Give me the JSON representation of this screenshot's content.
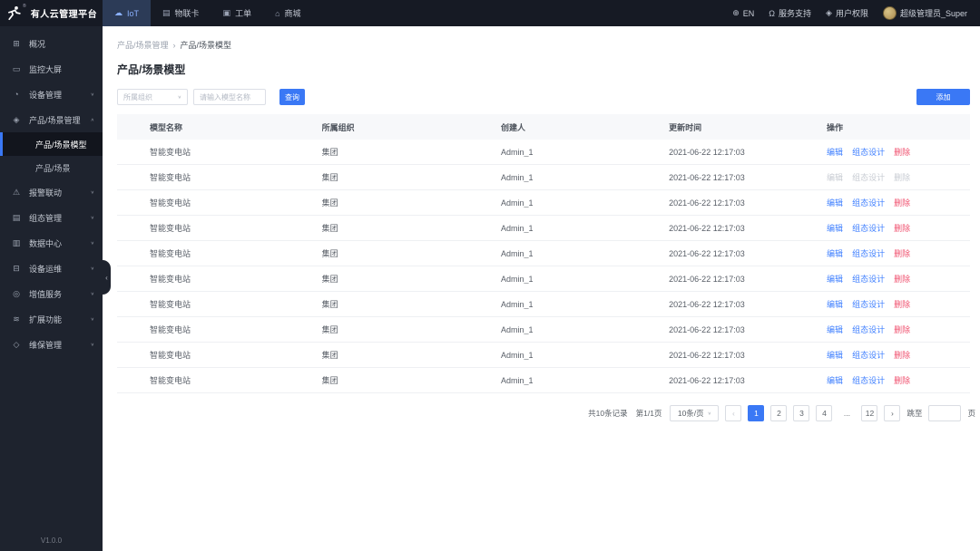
{
  "colors": {
    "accent": "#3a78f5",
    "link": "#4080ff",
    "danger": "#f0506e",
    "disabled": "#c8ccd3"
  },
  "icons": {
    "cloud-icon": "☁",
    "sim-card-icon": "▤",
    "work-order-icon": "▣",
    "store-icon": "⌂",
    "globe-icon": "⊕",
    "headset-icon": "Ω",
    "shield-icon": "◈",
    "overview-icon": "⊞",
    "monitor-icon": "▭",
    "device-manage-icon": "◔",
    "product-scene-icon": "◈",
    "alarm-icon": "⚠",
    "scada-icon": "▤",
    "data-center-icon": "▥",
    "device-ops-icon": "⊟",
    "value-added-icon": "◎",
    "extend-icon": "≋",
    "maintenance-icon": "◇",
    "chevron-down-icon": "∨",
    "chevron-up-icon": "∧",
    "collapse-icon": "‹"
  },
  "topbar": {
    "logo_text": "有人云管理平台",
    "reg_mark": "®",
    "nav": [
      {
        "key": "iot",
        "label": "IoT",
        "icon": "cloud-icon",
        "active": true
      },
      {
        "key": "sim",
        "label": "物联卡",
        "icon": "sim-card-icon",
        "active": false
      },
      {
        "key": "workorder",
        "label": "工单",
        "icon": "work-order-icon",
        "active": false
      },
      {
        "key": "mall",
        "label": "商城",
        "icon": "store-icon",
        "active": false
      }
    ],
    "right": {
      "lang": "EN",
      "support": "服务支持",
      "permission": "用户权限",
      "user": "超级管理员_Super"
    }
  },
  "sidebar": {
    "items": [
      {
        "key": "overview",
        "label": "概况",
        "icon": "overview-icon",
        "expandable": false
      },
      {
        "key": "monitor-screen",
        "label": "监控大屏",
        "icon": "monitor-icon",
        "expandable": false
      },
      {
        "key": "device-manage",
        "label": "设备管理",
        "icon": "device-manage-icon",
        "expandable": true,
        "expanded": false
      },
      {
        "key": "product-scene-manage",
        "label": "产品/场景管理",
        "icon": "product-scene-icon",
        "expandable": true,
        "expanded": true,
        "children": [
          {
            "key": "product-scene-model",
            "label": "产品/场景模型",
            "active": true
          },
          {
            "key": "product-scene",
            "label": "产品/场景",
            "active": false
          }
        ]
      },
      {
        "key": "alarm-linkage",
        "label": "报警联动",
        "icon": "alarm-icon",
        "expandable": true,
        "expanded": false
      },
      {
        "key": "scada-manage",
        "label": "组态管理",
        "icon": "scada-icon",
        "expandable": true,
        "expanded": false
      },
      {
        "key": "data-center",
        "label": "数据中心",
        "icon": "data-center-icon",
        "expandable": true,
        "expanded": false
      },
      {
        "key": "device-ops",
        "label": "设备运维",
        "icon": "device-ops-icon",
        "expandable": true,
        "expanded": false
      },
      {
        "key": "value-added",
        "label": "增值服务",
        "icon": "value-added-icon",
        "expandable": true,
        "expanded": false
      },
      {
        "key": "extend-func",
        "label": "扩展功能",
        "icon": "extend-icon",
        "expandable": true,
        "expanded": false
      },
      {
        "key": "maintenance",
        "label": "维保管理",
        "icon": "maintenance-icon",
        "expandable": true,
        "expanded": false
      }
    ],
    "version": "V1.0.0"
  },
  "breadcrumb": {
    "parent": "产品/场景管理",
    "separator": "›",
    "current": "产品/场景模型"
  },
  "page": {
    "title": "产品/场景模型"
  },
  "filters": {
    "org_select_placeholder": "所属组织",
    "model_input_placeholder": "请输入模型名称",
    "search_label": "查询",
    "add_label": "添加"
  },
  "table": {
    "columns": [
      "模型名称",
      "所属组织",
      "创建人",
      "更新时间",
      "操作"
    ],
    "action_labels": {
      "edit": "编辑",
      "design": "组态设计",
      "delete": "删除"
    },
    "rows": [
      {
        "name": "智能变电站",
        "org": "集团",
        "creator": "Admin_1",
        "updated": "2021-06-22 12:17:03",
        "disabled": false
      },
      {
        "name": "智能变电站",
        "org": "集团",
        "creator": "Admin_1",
        "updated": "2021-06-22 12:17:03",
        "disabled": true
      },
      {
        "name": "智能变电站",
        "org": "集团",
        "creator": "Admin_1",
        "updated": "2021-06-22 12:17:03",
        "disabled": false
      },
      {
        "name": "智能变电站",
        "org": "集团",
        "creator": "Admin_1",
        "updated": "2021-06-22 12:17:03",
        "disabled": false
      },
      {
        "name": "智能变电站",
        "org": "集团",
        "creator": "Admin_1",
        "updated": "2021-06-22 12:17:03",
        "disabled": false
      },
      {
        "name": "智能变电站",
        "org": "集团",
        "creator": "Admin_1",
        "updated": "2021-06-22 12:17:03",
        "disabled": false
      },
      {
        "name": "智能变电站",
        "org": "集团",
        "creator": "Admin_1",
        "updated": "2021-06-22 12:17:03",
        "disabled": false
      },
      {
        "name": "智能变电站",
        "org": "集团",
        "creator": "Admin_1",
        "updated": "2021-06-22 12:17:03",
        "disabled": false
      },
      {
        "name": "智能变电站",
        "org": "集团",
        "creator": "Admin_1",
        "updated": "2021-06-22 12:17:03",
        "disabled": false
      },
      {
        "name": "智能变电站",
        "org": "集团",
        "creator": "Admin_1",
        "updated": "2021-06-22 12:17:03",
        "disabled": false
      }
    ]
  },
  "pagination": {
    "total_text": "共10条记录",
    "page_text": "第1/1页",
    "page_size": "10条/页",
    "items": [
      {
        "label": "‹",
        "type": "prev",
        "disabled": true
      },
      {
        "label": "1",
        "type": "page",
        "active": true
      },
      {
        "label": "2",
        "type": "page"
      },
      {
        "label": "3",
        "type": "page"
      },
      {
        "label": "4",
        "type": "page"
      },
      {
        "label": "...",
        "type": "ellipsis"
      },
      {
        "label": "12",
        "type": "page"
      },
      {
        "label": "›",
        "type": "next"
      }
    ],
    "jump_label": "跳至",
    "jump_suffix": "页",
    "jump_value": ""
  }
}
